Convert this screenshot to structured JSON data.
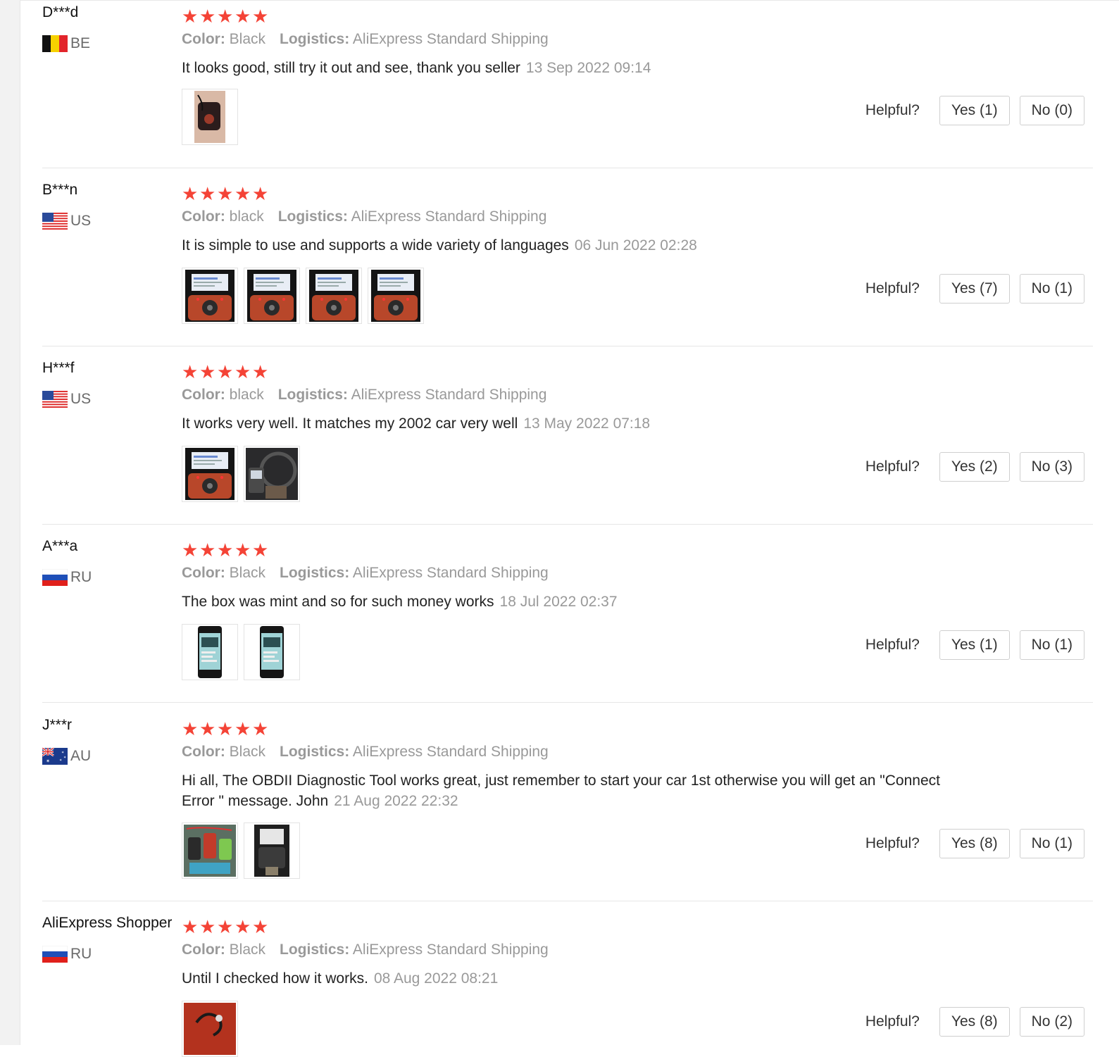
{
  "labels": {
    "color": "Color:",
    "logistics": "Logistics:",
    "helpful": "Helpful?"
  },
  "colors": {
    "star": "#f44336",
    "muted_text": "#999999",
    "divider": "#e6e6e6"
  },
  "reviews": [
    {
      "user": "D***d",
      "country": "BE",
      "flag": "flag-belgium-icon",
      "stars": 5,
      "color": "Black",
      "logistics": "AliExpress Standard Shipping",
      "text": "It looks good, still try it out and see, thank you seller",
      "date": "13 Sep 2022 09:14",
      "photos": [
        "photo-device-in-hand"
      ],
      "yes": "Yes (1)",
      "no": "No (0)"
    },
    {
      "user": "B***n",
      "country": "US",
      "flag": "flag-usa-icon",
      "stars": 5,
      "color": "black",
      "logistics": "AliExpress Standard Shipping",
      "text": "It is simple to use and supports a wide variety of languages",
      "date": "06 Jun 2022 02:28",
      "photos": [
        "photo-scanner-screen",
        "photo-scanner-screen",
        "photo-scanner-screen",
        "photo-scanner-screen"
      ],
      "yes": "Yes (7)",
      "no": "No (1)"
    },
    {
      "user": "H***f",
      "country": "US",
      "flag": "flag-usa-icon",
      "stars": 5,
      "color": "black",
      "logistics": "AliExpress Standard Shipping",
      "text": "It works very well. It matches my 2002 car very well",
      "date": "13 May 2022 07:18",
      "photos": [
        "photo-scanner-screen",
        "photo-car-interior"
      ],
      "yes": "Yes (2)",
      "no": "No (3)"
    },
    {
      "user": "A***a",
      "country": "RU",
      "flag": "flag-russia-icon",
      "stars": 5,
      "color": "Black",
      "logistics": "AliExpress Standard Shipping",
      "text": "The box was mint and so for such money works",
      "date": "18 Jul 2022 02:37",
      "photos": [
        "photo-phone-screenshot",
        "photo-phone-screenshot"
      ],
      "yes": "Yes (1)",
      "no": "No (1)"
    },
    {
      "user": "J***r",
      "country": "AU",
      "flag": "flag-australia-icon",
      "stars": 5,
      "color": "Black",
      "logistics": "AliExpress Standard Shipping",
      "text": "Hi all, The OBDII Diagnostic Tool works great, just remember to start your car 1st otherwise you will get an \"Connect Error \" message. John",
      "date": "21 Aug 2022 22:32",
      "photos": [
        "photo-tools-on-table",
        "photo-scanner-in-car"
      ],
      "yes": "Yes (8)",
      "no": "No (1)"
    },
    {
      "user": "AliExpress Shopper",
      "country": "RU",
      "flag": "flag-russia-icon",
      "stars": 5,
      "color": "Black",
      "logistics": "AliExpress Standard Shipping",
      "text": "Until I checked how it works.",
      "date": "08 Aug 2022 08:21",
      "photos": [
        "photo-device-on-red"
      ],
      "yes": "Yes (8)",
      "no": "No (2)"
    }
  ]
}
